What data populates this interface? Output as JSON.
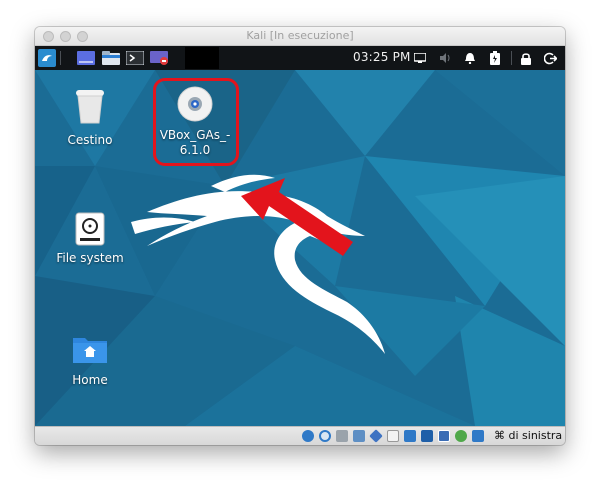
{
  "window": {
    "title": "Kali [In esecuzione]"
  },
  "panel": {
    "clock": "03:25 PM",
    "icons": [
      "kali-menu-icon",
      "workspace-icon",
      "file-manager-icon",
      "terminal-icon",
      "screen-recorder-icon",
      "display-icon",
      "volume-icon",
      "notifications-icon",
      "battery-icon",
      "lock-icon",
      "logout-icon"
    ]
  },
  "desktop": {
    "icons": [
      {
        "label": "Cestino",
        "icon": "trash-icon"
      },
      {
        "label": "VBox_GAs_-\n6.1.0",
        "icon": "optical-disc-icon"
      },
      {
        "label": "File system",
        "icon": "drive-icon"
      },
      {
        "label": "Home",
        "icon": "home-folder-icon"
      }
    ],
    "annotation": {
      "highlight_color": "#e3141c",
      "arrow_color": "#e3141c"
    }
  },
  "statusbar": {
    "host_key_label": "⌘ di sinistra",
    "icons": [
      "hard-disk-icon",
      "optical-drive-icon",
      "audio-icon",
      "network-icon",
      "usb-icon",
      "shared-folder-icon",
      "display-icon",
      "video-capture-icon",
      "cpu-icon",
      "virtualization-icon",
      "mouse-integration-icon"
    ]
  },
  "colors": {
    "panel_bg": "#111417",
    "desktop_bg": "#1a6f97",
    "accent": "#e3141c"
  }
}
